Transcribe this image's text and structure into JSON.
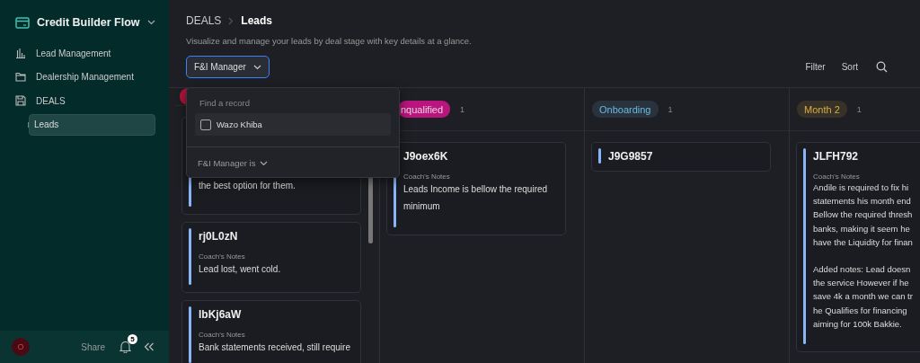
{
  "sidebar": {
    "workspace": "Credit Builder Flow",
    "items": [
      {
        "label": "Lead Management",
        "selected": false
      },
      {
        "label": "Dealership Management",
        "selected": false
      },
      {
        "label": "DEALS",
        "selected": false,
        "children": [
          {
            "label": "Leads",
            "selected": true
          }
        ]
      }
    ],
    "footer": {
      "avatar": "O",
      "share": "Share",
      "notifications": "5"
    }
  },
  "breadcrumb": [
    "DEALS",
    "Leads"
  ],
  "subtitle": "Visualize and manage your leads by deal stage with key details at a glance.",
  "filter_button": {
    "label": "F&I Manager",
    "focused": true
  },
  "toolbar": [
    "Filter",
    "Sort"
  ],
  "filter_popup": {
    "placeholder": "Find a record",
    "options": [
      {
        "label": "Wazo Khiba",
        "checked": false
      }
    ],
    "condition": "F&I Manager is"
  },
  "columns": [
    {
      "color": "#b3123b",
      "kind": "solid",
      "cards": [
        {
          "notes": [
            "the best option for them."
          ]
        },
        {
          "id": "rj0L0zN",
          "notes_label": "Coach's Notes",
          "notes": [
            "Lead lost, went cold."
          ]
        },
        {
          "id": "lbKj6aW",
          "notes_label": "Coach's Notes",
          "notes": [
            "Bank statements received, still require"
          ]
        }
      ]
    },
    {
      "label": "nqualified",
      "count": "1",
      "color": "#b8157f",
      "kind": "solid",
      "cards": [
        {
          "id": "J9oex6K",
          "notes_label": "Coach's Notes",
          "notes": [
            "Leads Income is bellow the required minimum"
          ]
        }
      ]
    },
    {
      "label": "Onboarding",
      "count": "1",
      "color": "#6cb8e0",
      "kind": "soft",
      "cards": [
        {
          "id": "J9G9857"
        }
      ]
    },
    {
      "label": "Month 2",
      "count": "1",
      "color": "#d6ae45",
      "kind": "soft",
      "cards": [
        {
          "id": "JLFH792",
          "notes_label": "Coach's Notes",
          "paragraphs": [
            [
              "Andile is required to fix hi",
              "statements his month end",
              "Bellow the required thresh",
              "banks, making it seem he",
              "have the Liquidity for finan"
            ],
            [
              "Added notes: Lead doesn",
              "the service However if he",
              "save 4k a month we can tr",
              "he Qualifies for financing",
              "aiming for 100k Bakkie."
            ]
          ]
        }
      ]
    }
  ]
}
